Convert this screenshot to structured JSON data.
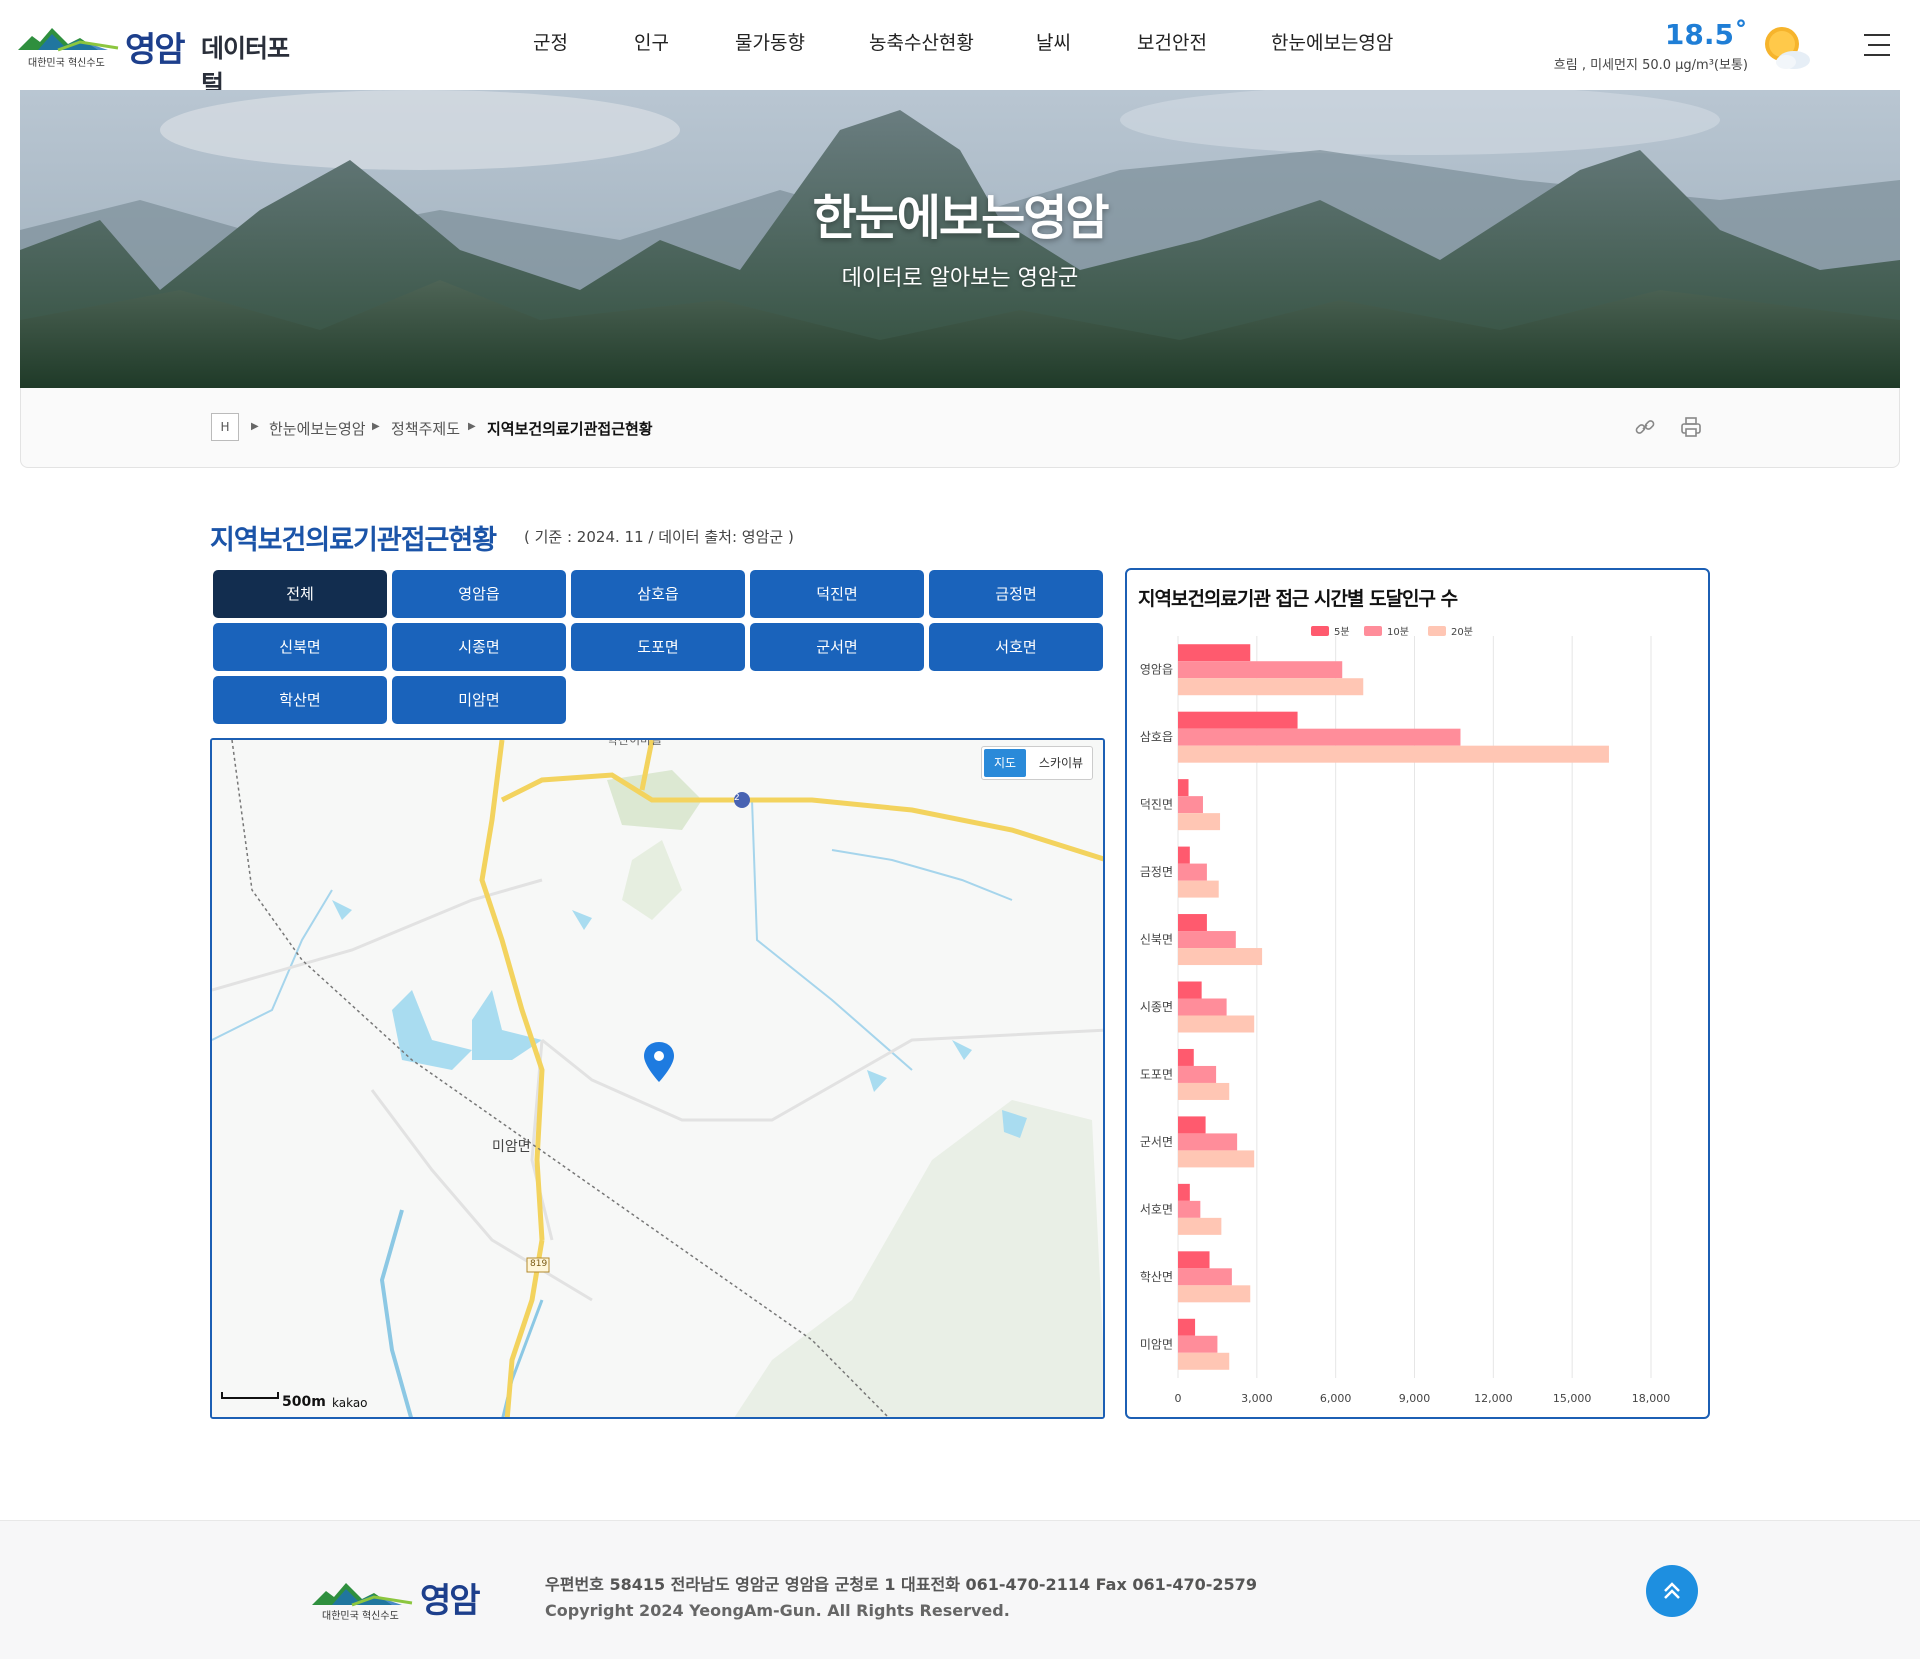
{
  "header": {
    "logo_slogan": "대한민국 혁신수도",
    "logo_name": "영암",
    "portal_name": "데이터포털",
    "nav": [
      "군정",
      "인구",
      "물가동향",
      "농축수산현황",
      "날씨",
      "보건안전",
      "한눈에보는영암"
    ],
    "weather": {
      "temperature": "18.5˚",
      "description": "흐림 , 미세먼지 50.0 μg/m³(보통)",
      "icon": "sun-cloud-icon"
    }
  },
  "hero": {
    "title": "한눈에보는영암",
    "subtitle": "데이터로 알아보는 영암군"
  },
  "breadcrumb": {
    "home": "H",
    "items": [
      "한눈에보는영암",
      "정책주제도",
      "지역보건의료기관접근현황"
    ]
  },
  "page": {
    "title": "지역보건의료기관접근현황",
    "meta": "( 기준 : 2024. 11 / 데이터 출처: 영암군 )"
  },
  "tabs": [
    "전체",
    "영암읍",
    "삼호읍",
    "덕진면",
    "금정면",
    "신북면",
    "시종면",
    "도포면",
    "군서면",
    "서호면",
    "학산면",
    "미암면"
  ],
  "active_tab": "전체",
  "map": {
    "toggle": [
      "지도",
      "스카이뷰"
    ],
    "labels": {
      "area": "미암면",
      "top_road": "학산이마을",
      "route_2": "2",
      "route_819": "819"
    },
    "scale": "500m",
    "provider": "kakao"
  },
  "chart_data": {
    "type": "bar",
    "orientation": "horizontal",
    "title": "지역보건의료기관 접근 시간별 도달인구 수",
    "categories": [
      "영암읍",
      "삼호읍",
      "덕진면",
      "금정면",
      "신북면",
      "시종면",
      "도포면",
      "군서면",
      "서호면",
      "학산면",
      "미암면"
    ],
    "series": [
      {
        "name": "5분",
        "color": "#ff5a6e",
        "values": [
          2750,
          4550,
          400,
          450,
          1100,
          900,
          600,
          1050,
          450,
          1200,
          650
        ]
      },
      {
        "name": "10분",
        "color": "#ff8d9a",
        "values": [
          6250,
          10750,
          950,
          1100,
          2200,
          1850,
          1450,
          2250,
          850,
          2050,
          1500
        ]
      },
      {
        "name": "20분",
        "color": "#ffc6b4",
        "values": [
          7050,
          16400,
          1600,
          1550,
          3200,
          2900,
          1950,
          2900,
          1650,
          2750,
          1950
        ]
      }
    ],
    "xlim": [
      0,
      18000
    ],
    "xticks": [
      "0",
      "3,000",
      "6,000",
      "9,000",
      "12,000",
      "15,000",
      "18,000"
    ],
    "legend": "top"
  },
  "footer": {
    "address": "우편번호 58415 전라남도 영암군 영암읍 군청로 1  대표전화 061-470-2114  Fax 061-470-2579",
    "copyright": "Copyright 2024 YeongAm-Gun. All Rights Reserved.",
    "logo_slogan": "대한민국 혁신수도",
    "logo_name": "영암"
  }
}
